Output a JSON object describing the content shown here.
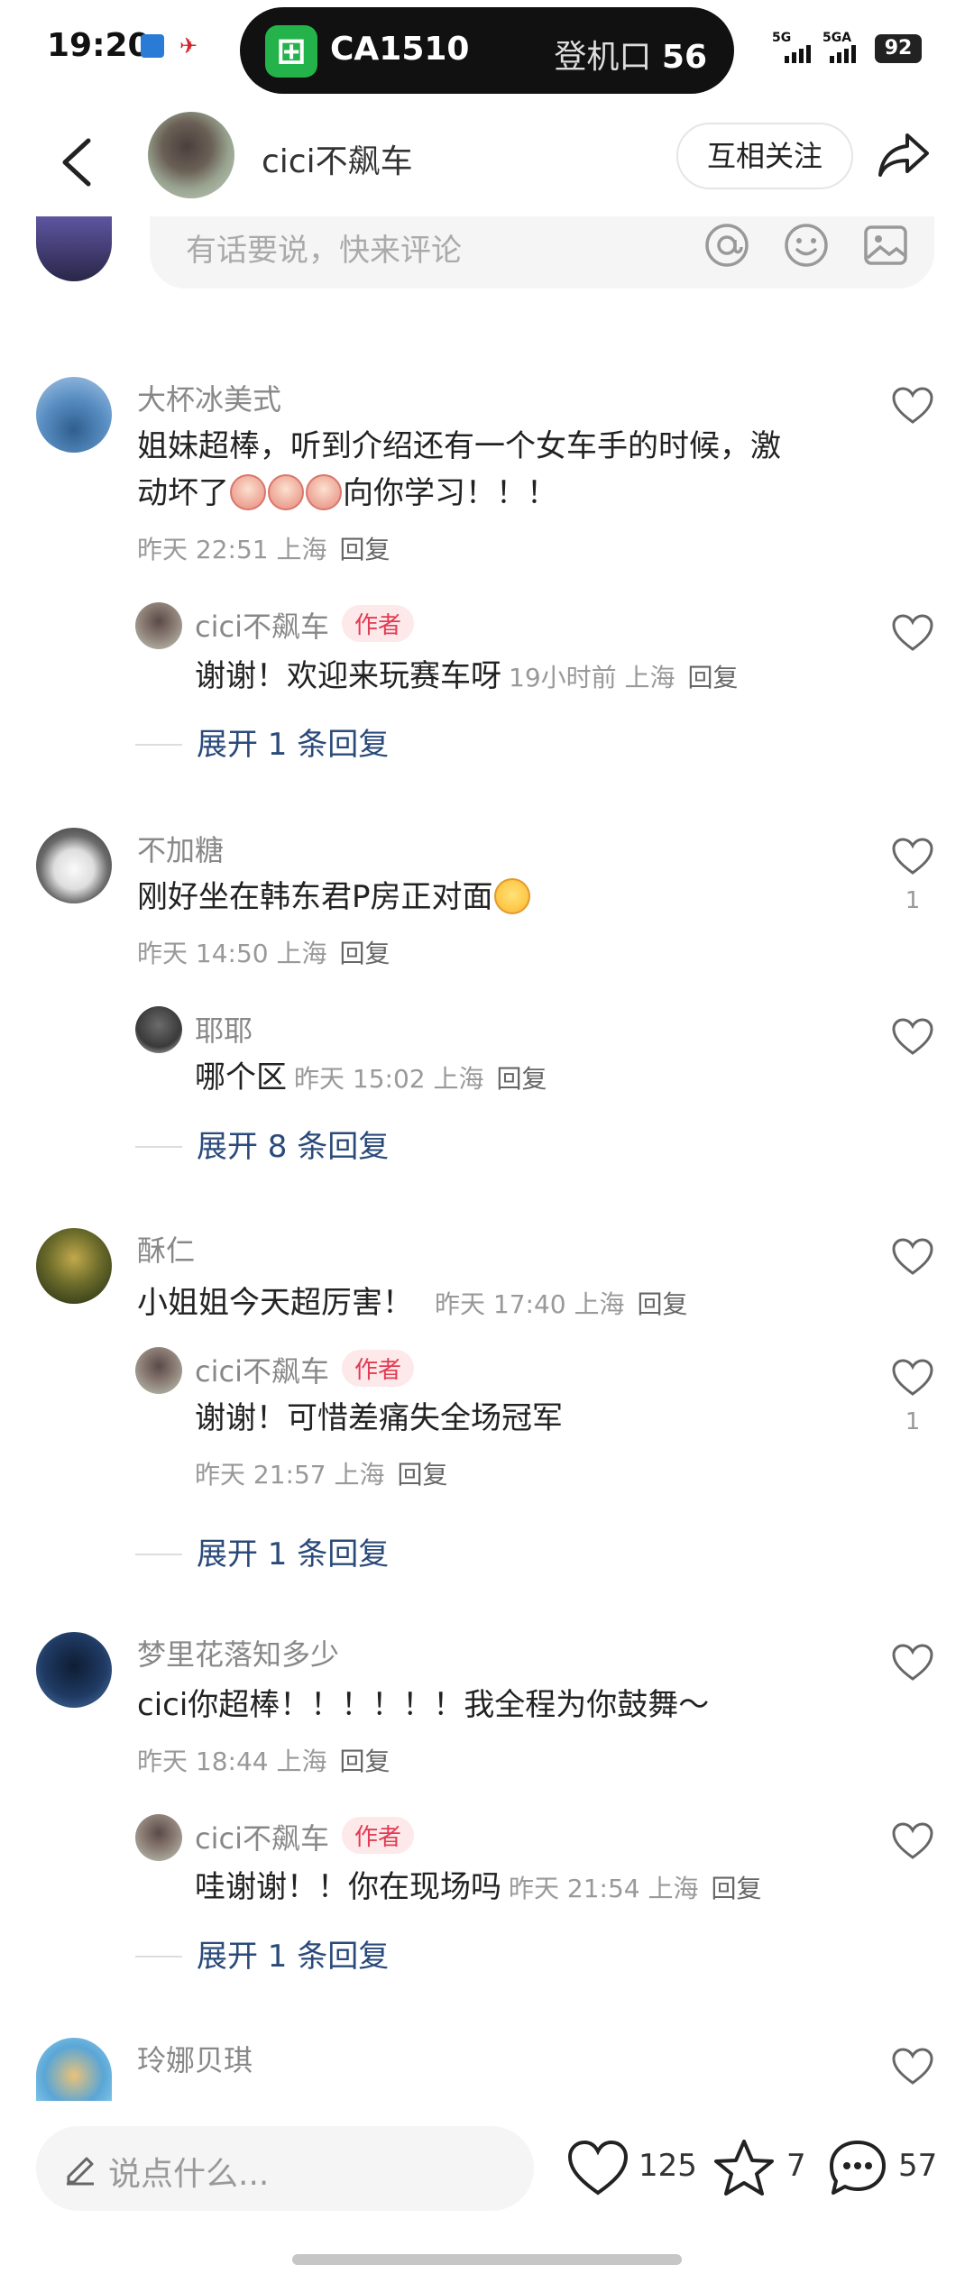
{
  "status_bar": {
    "time": "19:20",
    "flight": "CA1510",
    "gate_label": "登机口",
    "gate_number": "56",
    "signal_1": "5G",
    "signal_2": "5GA",
    "battery": "92"
  },
  "header": {
    "username": "cici不飙车",
    "follow_label": "互相关注"
  },
  "comment_input": {
    "placeholder": "有话要说，快来评论"
  },
  "comments": [
    {
      "user": "大杯冰美式",
      "text_line1": "姐妹超棒，听到介绍还有一个女车手的时候，激",
      "text_line2_pre": "动坏了",
      "text_line2_post": "向你学习！！！",
      "time": "昨天 22:51 上海",
      "reply": "回复",
      "sub": {
        "user": "cici不飙车",
        "tag": "作者",
        "text": "谢谢！欢迎来玩赛车呀",
        "time": "19小时前 上海",
        "reply": "回复"
      },
      "expand": "展开 1 条回复"
    },
    {
      "user": "不加糖",
      "text": "刚好坐在韩东君P房正对面",
      "time": "昨天 14:50 上海",
      "reply": "回复",
      "likes": "1",
      "sub": {
        "user": "耶耶",
        "text": "哪个区",
        "time": "昨天 15:02 上海",
        "reply": "回复"
      },
      "expand": "展开 8 条回复"
    },
    {
      "user": "酥仁",
      "text": "小姐姐今天超厉害！",
      "time": "昨天 17:40 上海",
      "reply": "回复",
      "sub": {
        "user": "cici不飙车",
        "tag": "作者",
        "text": "谢谢！可惜差痛失全场冠军",
        "time": "昨天 21:57 上海",
        "reply": "回复",
        "likes": "1"
      },
      "expand": "展开 1 条回复"
    },
    {
      "user": "梦里花落知多少",
      "text": "cici你超棒！！！！！！我全程为你鼓舞～",
      "time": "昨天 18:44 上海",
      "reply": "回复",
      "sub": {
        "user": "cici不飙车",
        "tag": "作者",
        "text": "哇谢谢！！你在现场吗",
        "time": "昨天 21:54 上海",
        "reply": "回复"
      },
      "expand": "展开 1 条回复"
    },
    {
      "user": "玲娜贝琪"
    }
  ],
  "bottom_bar": {
    "placeholder": "说点什么...",
    "likes": "125",
    "stars": "7",
    "comments": "57"
  }
}
